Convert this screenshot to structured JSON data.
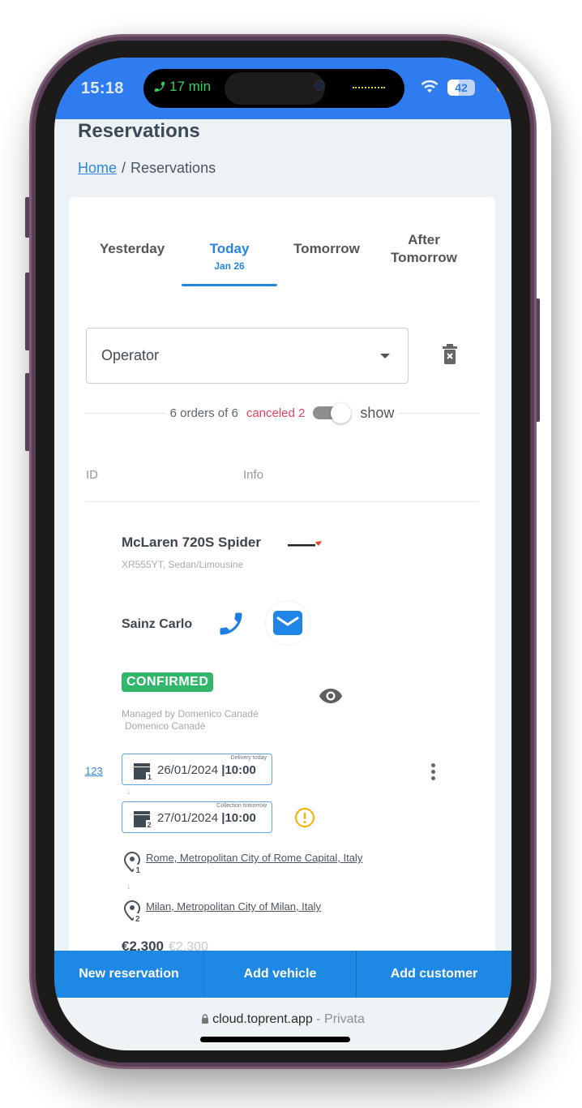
{
  "status_bar": {
    "time": "15:18",
    "call_duration": "17 min",
    "battery_level": "42",
    "battery_percent": 42
  },
  "page": {
    "title": "Reservations",
    "breadcrumb": {
      "home": "Home",
      "separator": "/",
      "current": "Reservations"
    }
  },
  "tabs": [
    {
      "label": "Yesterday",
      "sub": ""
    },
    {
      "label": "Today",
      "sub": "Jan 26",
      "active": true
    },
    {
      "label": "Tomorrow",
      "sub": ""
    },
    {
      "label": "After Tomorrow",
      "sub": ""
    }
  ],
  "filter": {
    "operator_placeholder": "Operator",
    "clear_icon": "trash-x-icon"
  },
  "summary": {
    "orders_text": "6 orders of 6",
    "canceled_text": "canceled 2",
    "show_label": "show",
    "toggle_on": true
  },
  "table": {
    "columns": [
      "ID",
      "Info"
    ]
  },
  "reservation": {
    "id": "123",
    "vehicle_name": "McLaren 720S Spider",
    "vehicle_sub": "XR555YT, Sedan/Limousine",
    "brand_logo": "mclaren-logo",
    "customer_name": "Sainz Carlo",
    "status": "CONFIRMED",
    "managed_by": "Managed by Domenico Canadè",
    "managed_name": "Domenico Canadè",
    "delivery": {
      "caption": "Delivery today",
      "date": "26/01/2024",
      "separator": "|",
      "time": "10:00"
    },
    "collection": {
      "caption": "Collection tomorrow",
      "date": "27/01/2024",
      "separator": "|",
      "time": "10:00"
    },
    "pickup_location": "Rome, Metropolitan City of Rome Capital, Italy",
    "return_location": "Milan, Metropolitan City of Milan, Italy",
    "price": "€2.300",
    "price_original": "€2.300"
  },
  "actions": {
    "new_reservation": "New reservation",
    "add_vehicle": "Add vehicle",
    "add_customer": "Add customer"
  },
  "browser": {
    "domain": "cloud.toprent.app",
    "mode": "- Privata"
  },
  "colors": {
    "accent": "#1e88e5",
    "status_bar": "#2f7cf0",
    "confirmed": "#31b76b",
    "canceled": "#e2445c",
    "warning": "#f5b50f"
  }
}
